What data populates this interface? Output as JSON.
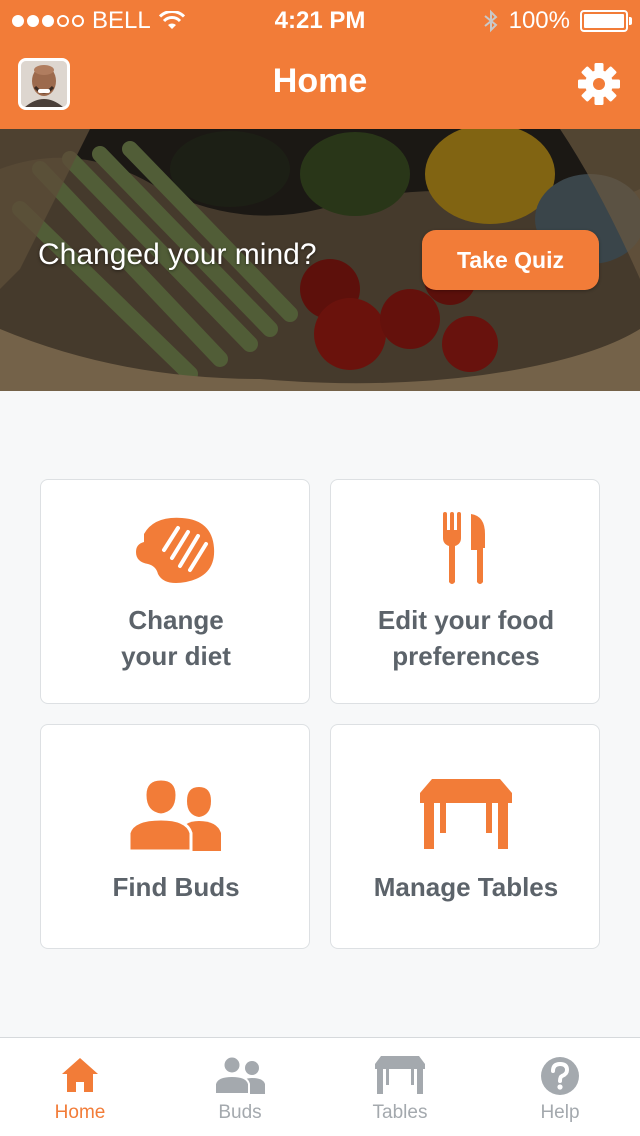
{
  "status_bar": {
    "carrier": "BELL",
    "time": "4:21 PM",
    "battery": "100%"
  },
  "header": {
    "title": "Home",
    "avatar_icon": "user-avatar",
    "settings_icon": "gear-icon"
  },
  "hero": {
    "text": "Changed your mind?",
    "button_label": "Take Quiz"
  },
  "cards": [
    {
      "icon": "steak-icon",
      "line1": "Change",
      "line2": "your diet"
    },
    {
      "icon": "fork-knife-icon",
      "line1": "Edit your food",
      "line2": "preferences"
    },
    {
      "icon": "buds-icon",
      "line1": "Find Buds"
    },
    {
      "icon": "table-icon",
      "line1": "Manage Tables"
    }
  ],
  "tabs": [
    {
      "label": "Home",
      "icon": "home-icon",
      "active": true
    },
    {
      "label": "Buds",
      "icon": "buds-icon",
      "active": false
    },
    {
      "label": "Tables",
      "icon": "table-icon",
      "active": false
    },
    {
      "label": "Help",
      "icon": "help-icon",
      "active": false
    }
  ],
  "colors": {
    "accent": "#f27c38",
    "card_text": "#5c636a",
    "tab_inactive": "#a4a9ae",
    "background": "#f7f8f9"
  }
}
